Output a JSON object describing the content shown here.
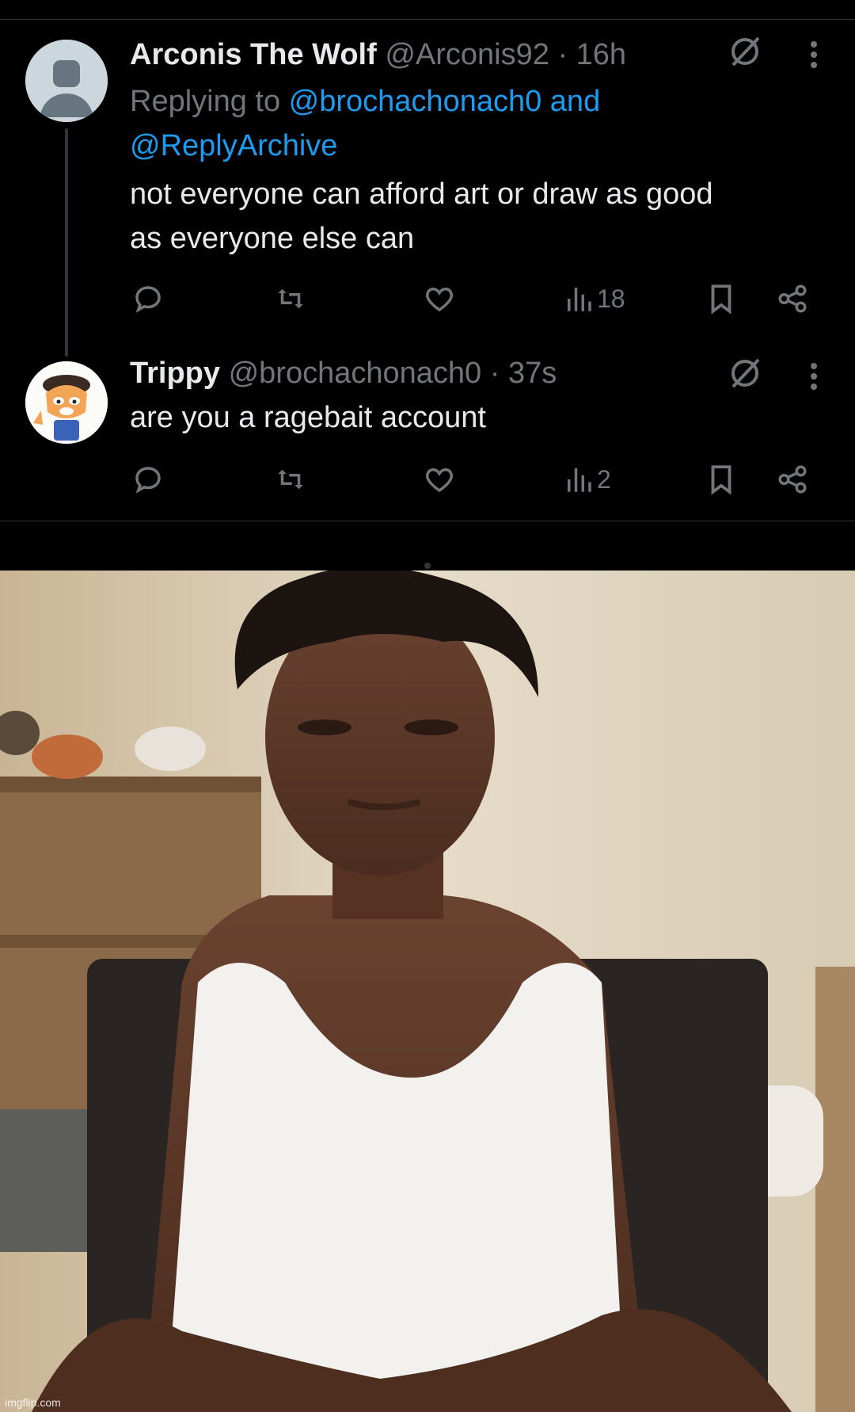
{
  "tweets": [
    {
      "name": "Arconis The Wolf",
      "handle": "@Arconis92",
      "time": "· 16h",
      "replying_prefix": "Replying to ",
      "replying_links": "@brochachonach0 and @ReplyArchive",
      "text_lines": [
        "not everyone can afford art or draw as good",
        "as everyone else can"
      ],
      "views": "18"
    },
    {
      "name": "Trippy",
      "handle": "@brochachonach0",
      "time": "· 37s",
      "text_lines": [
        "are you a ragebait account"
      ],
      "views": "2"
    }
  ],
  "icons": {
    "reply": "reply-icon",
    "retweet": "retweet-icon",
    "like": "heart-icon",
    "views": "views-icon",
    "bookmark": "bookmark-icon",
    "share": "share-icon",
    "grok": "grok-icon",
    "more": "more-icon"
  },
  "colors": {
    "background": "#000000",
    "link": "#1d9bf0",
    "muted": "#71767b",
    "text": "#e7e9ea"
  },
  "watermark": "imgflip.com"
}
